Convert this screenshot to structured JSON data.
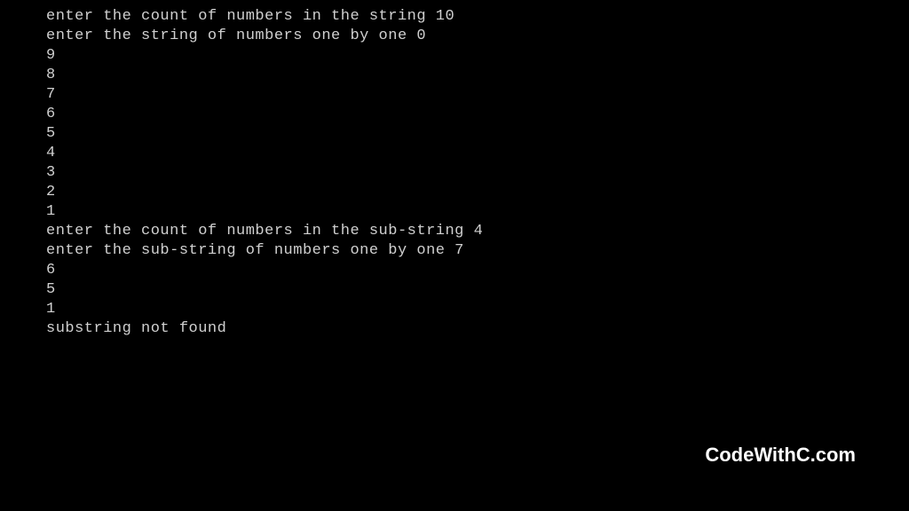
{
  "terminal": {
    "lines": [
      "enter the count of numbers in the string 10",
      "enter the string of numbers one by one 0",
      "9",
      "8",
      "7",
      "6",
      "5",
      "4",
      "3",
      "2",
      "1",
      "enter the count of numbers in the sub-string 4",
      "enter the sub-string of numbers one by one 7",
      "6",
      "5",
      "1",
      "substring not found"
    ]
  },
  "watermark": "CodeWithC.com"
}
